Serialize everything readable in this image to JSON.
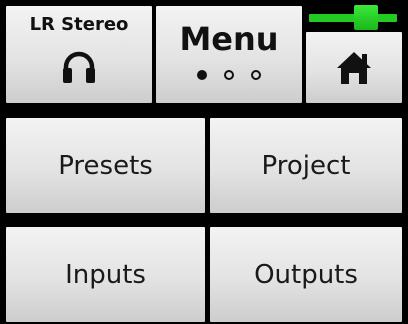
{
  "header": {
    "monitor_label": "LR Stereo",
    "menu_title": "Menu",
    "page_indicator": {
      "current": 1,
      "total": 3
    },
    "level_meter": {
      "level": 0.7,
      "color": "#22cc22"
    }
  },
  "buttons": {
    "presets": "Presets",
    "project": "Project",
    "inputs": "Inputs",
    "outputs": "Outputs"
  },
  "icons": {
    "monitor": "headphones-icon",
    "home": "home-icon"
  }
}
